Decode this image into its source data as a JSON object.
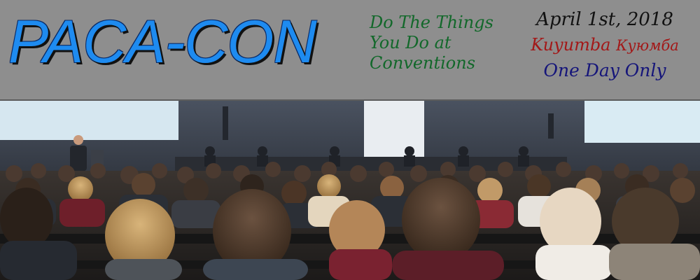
{
  "header": {
    "title": "PACA-CON",
    "tagline": "Do The Things You Do at Conventions",
    "date": "April 1st, 2018",
    "venue": "Kuyumba",
    "venue_cyrillic": "Куюмба",
    "duration": "One Day Only"
  },
  "photo": {
    "subject": "conference-audience-photo"
  },
  "colors": {
    "header_bg": "#8e8e8e",
    "title": "#1e8bf0",
    "tagline": "#12682a",
    "venue": "#a31818",
    "duration": "#15157a"
  }
}
